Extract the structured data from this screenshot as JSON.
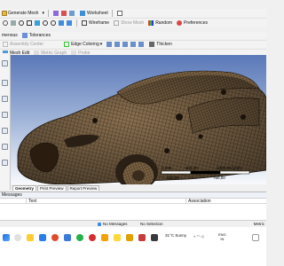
{
  "toolbar1": {
    "generate_mesh": "Generate Mesh",
    "worksheet": "Worksheet"
  },
  "toolbar2": {
    "wireframe": "Wireframe",
    "show_mesh": "Show Mesh",
    "random": "Random",
    "preferences": "Preferences"
  },
  "toolbar3": {
    "body_fragment": "menous",
    "tolerances": "Tolerances"
  },
  "toolbar4": {
    "assembly_center": "Assembly Center",
    "edge_coloring": "Edge Coloring",
    "thicken": "Thicken"
  },
  "toolbar5": {
    "mesh_edit": "Mesh Edit",
    "metric_graph": "Metric Graph",
    "probe": "Probe"
  },
  "scale_bar": {
    "top_left": "0,000",
    "top_mid": "500,00",
    "top_right": "1000,00 (mm)",
    "bottom_mid1": "250,00",
    "bottom_mid2": "750,00"
  },
  "bottom_tabs": [
    "Geometry",
    "Print Preview",
    "Report Preview"
  ],
  "messages": {
    "title": "Messages",
    "col_text": "Text",
    "col_association": "Association"
  },
  "status": {
    "no_messages": "No Messages",
    "no_selection": "No Selection",
    "metric": "Metric"
  },
  "taskbar": {
    "weather": "31°C",
    "weather_desc": "Sunny",
    "lang": "ENG",
    "region": "IN"
  },
  "colors": {
    "mesh_fill": "#8a7050",
    "mesh_line": "#2a1e12",
    "viewport_top": "#5a78b8",
    "accent": "#2d6ad8"
  }
}
